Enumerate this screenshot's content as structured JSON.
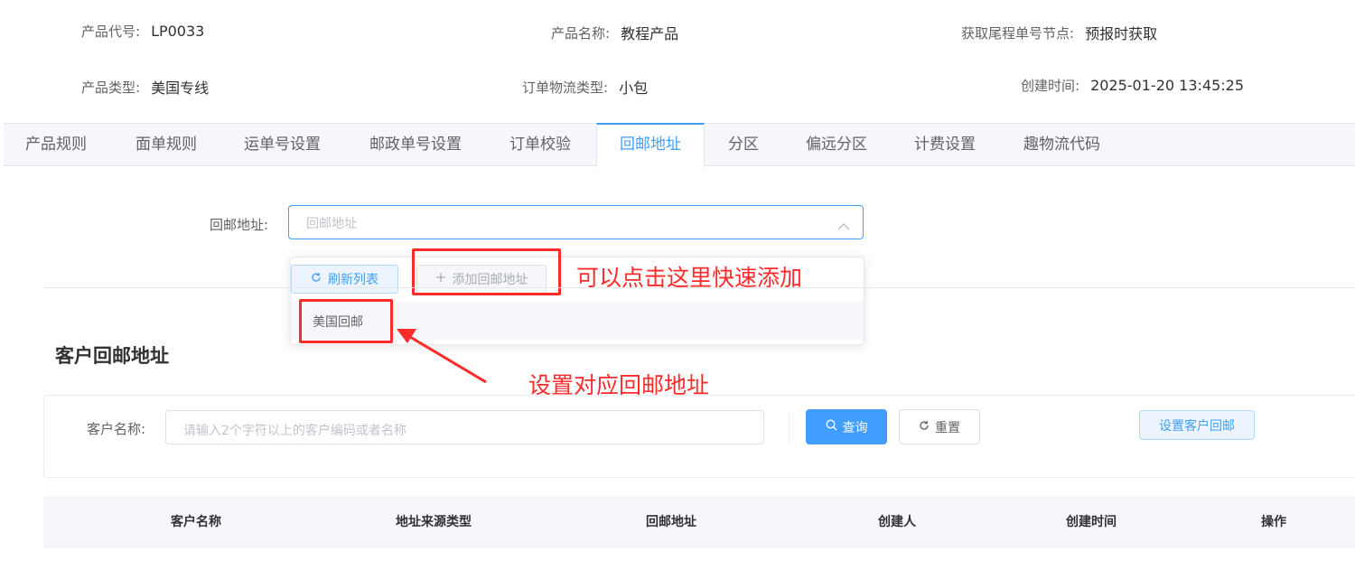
{
  "info": {
    "product_code_label": "产品代号:",
    "product_code_value": "LP0033",
    "product_name_label": "产品名称:",
    "product_name_value": "教程产品",
    "tail_node_label": "获取尾程单号节点:",
    "tail_node_value": "预报时获取",
    "product_type_label": "产品类型:",
    "product_type_value": "美国专线",
    "logistics_type_label": "订单物流类型:",
    "logistics_type_value": "小包",
    "created_label": "创建时间:",
    "created_value": "2025-01-20 13:45:25"
  },
  "tabs": [
    "产品规则",
    "面单规则",
    "运单号设置",
    "邮政单号设置",
    "订单校验",
    "回邮地址",
    "分区",
    "偏远分区",
    "计费设置",
    "趣物流代码"
  ],
  "active_tab": "回邮地址",
  "form": {
    "return_address_label": "回邮地址:",
    "return_address_placeholder": "回邮地址",
    "refresh_button": "刷新列表",
    "add_button": "添加回邮地址",
    "options": [
      "美国回邮"
    ]
  },
  "annotations": {
    "quick_add": "可以点击这里快速添加",
    "set_address": "设置对应回邮地址"
  },
  "customer_section": {
    "title": "客户回邮地址",
    "customer_name_label": "客户名称:",
    "customer_name_placeholder": "请输入2个字符以上的客户编码或者名称",
    "search_button": "查询",
    "reset_button": "重置",
    "set_button": "设置客户回邮"
  },
  "table": {
    "columns": [
      "客户名称",
      "地址来源类型",
      "回邮地址",
      "创建人",
      "创建时间",
      "操作"
    ]
  },
  "colors": {
    "primary": "#409eff",
    "annotation_red": "#ff2a2a"
  }
}
